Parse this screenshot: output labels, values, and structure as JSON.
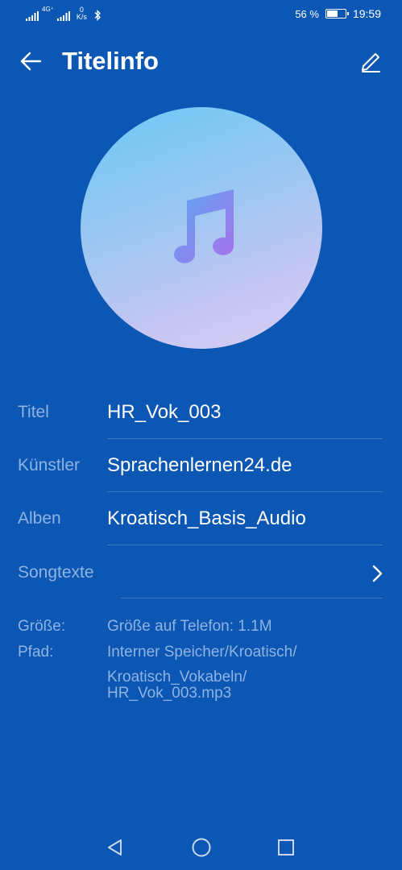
{
  "status_bar": {
    "network_left": "4G⁺",
    "net_speed_value": "0",
    "net_speed_unit": "K/s",
    "battery_percent_text": "56 %",
    "battery_level": 0.56,
    "time": "19:59",
    "icons": [
      "signal-icon",
      "signal-icon",
      "bluetooth-icon",
      "battery-icon"
    ]
  },
  "header": {
    "title": "Titelinfo",
    "back_icon": "arrow-left-icon",
    "edit_icon": "pencil-icon"
  },
  "artwork": {
    "icon": "music-note-icon"
  },
  "fields": [
    {
      "label": "Titel",
      "value": "HR_Vok_003"
    },
    {
      "label": "Künstler",
      "value": "Sprachenlernen24.de"
    },
    {
      "label": "Alben",
      "value": "Kroatisch_Basis_Audio"
    }
  ],
  "lyrics": {
    "label": "Songtexte",
    "icon": "chevron-right-icon"
  },
  "meta": {
    "size_label": "Größe:",
    "size_value": "Größe auf Telefon: 1.1M",
    "path_label": "Pfad:",
    "path_lines": [
      "Interner Speicher/Kroatisch/",
      "Kroatisch_Vokabeln/",
      "HR_Vok_003.mp3"
    ]
  },
  "nav_bar": {
    "icons": [
      "back-triangle-icon",
      "home-circle-icon",
      "recents-square-icon"
    ]
  }
}
